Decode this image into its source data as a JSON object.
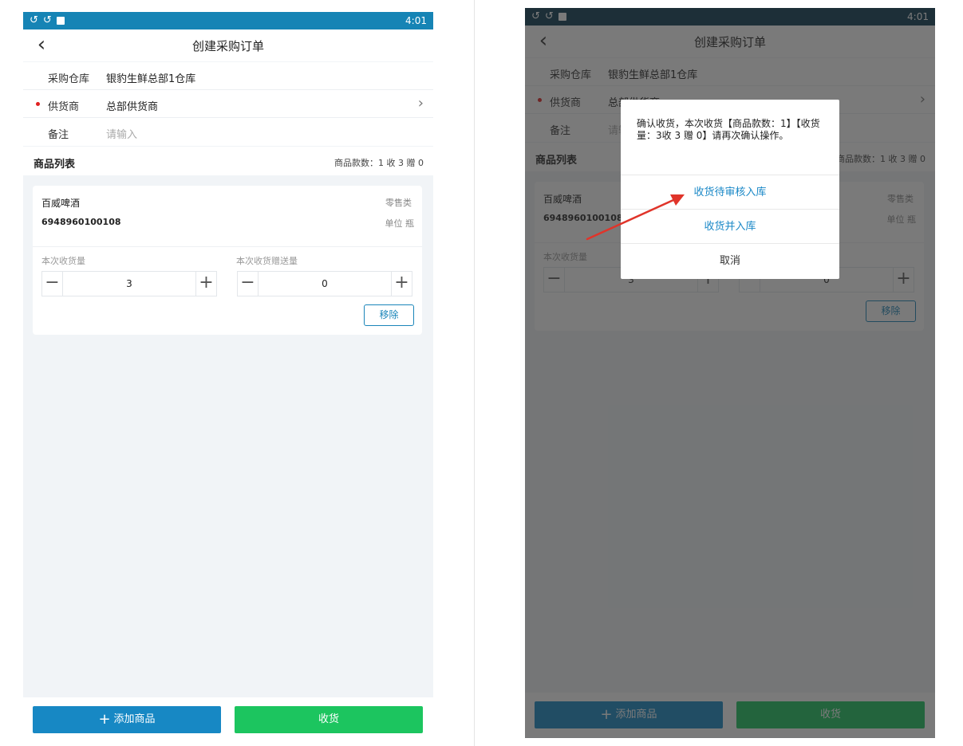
{
  "status_bar": {
    "time": "4:01"
  },
  "header": {
    "title": "创建采购订单"
  },
  "form": {
    "warehouse": {
      "label": "采购仓库",
      "value": "银豹生鲜总部1仓库"
    },
    "supplier": {
      "label": "供货商",
      "value": "总部供货商"
    },
    "remark": {
      "label": "备注",
      "placeholder": "请输入"
    }
  },
  "product_list": {
    "title": "商品列表",
    "stats": "商品款数：1  收 3 赠 0",
    "items": [
      {
        "name": "百威啤酒",
        "barcode": "6948960100108",
        "category": "零售类",
        "unit": "单位 瓶",
        "receive_label": "本次收货量",
        "receive_qty": "3",
        "gift_label": "本次收货赠送量",
        "gift_qty": "0",
        "remove_label": "移除"
      }
    ]
  },
  "bottom": {
    "add_label": "添加商品",
    "receive_label": "收货"
  },
  "dialog": {
    "message": "确认收货，本次收货【商品款数：1】【收货量：3收 3 赠 0】请再次确认操作。",
    "option_pending": "收货待审核入库",
    "option_stock": "收货并入库",
    "option_cancel": "取消"
  },
  "colors": {
    "primary": "#1788c4",
    "success": "#1cc55f",
    "annotation_arrow": "#e0342a"
  }
}
